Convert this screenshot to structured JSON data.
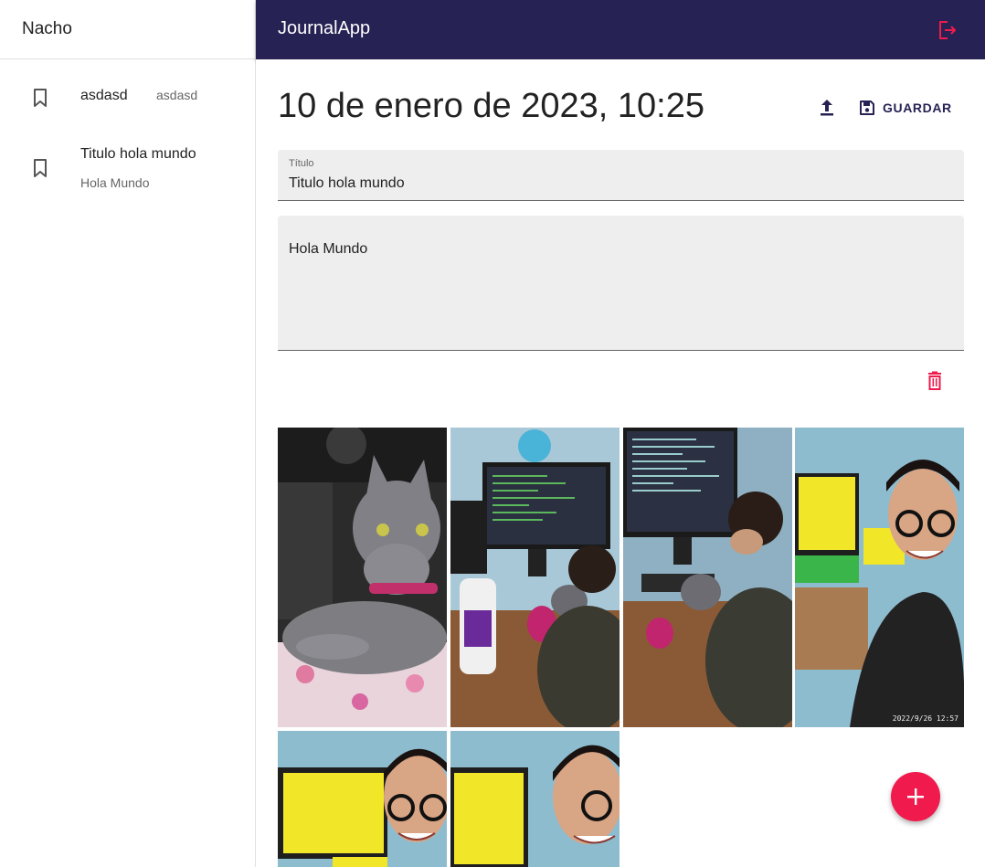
{
  "sidebar": {
    "user_name": "Nacho",
    "entries": [
      {
        "title": "asdasd",
        "body": "asdasd"
      },
      {
        "title": "Titulo hola mundo",
        "body": "Hola Mundo"
      }
    ]
  },
  "topbar": {
    "app_title": "JournalApp",
    "logout_icon": "logout-icon"
  },
  "note": {
    "date": "10 de enero de 2023, 10:25",
    "save_label": "GUARDAR",
    "title_label": "Título",
    "title_value": "Titulo hola mundo",
    "body_value": "Hola Mundo"
  },
  "gallery": {
    "images": [
      {
        "subject": "gray cat with pink collar"
      },
      {
        "subject": "person at computer with cat"
      },
      {
        "subject": "person coding with cat"
      },
      {
        "subject": "smiling man selfie",
        "timestamp": "2022/9/26 12:57"
      },
      {
        "subject": "smiling man selfie"
      },
      {
        "subject": "smiling man selfie"
      }
    ]
  },
  "colors": {
    "topbar": "#262254",
    "accent": "#f01a4d",
    "primary": "#262254"
  }
}
